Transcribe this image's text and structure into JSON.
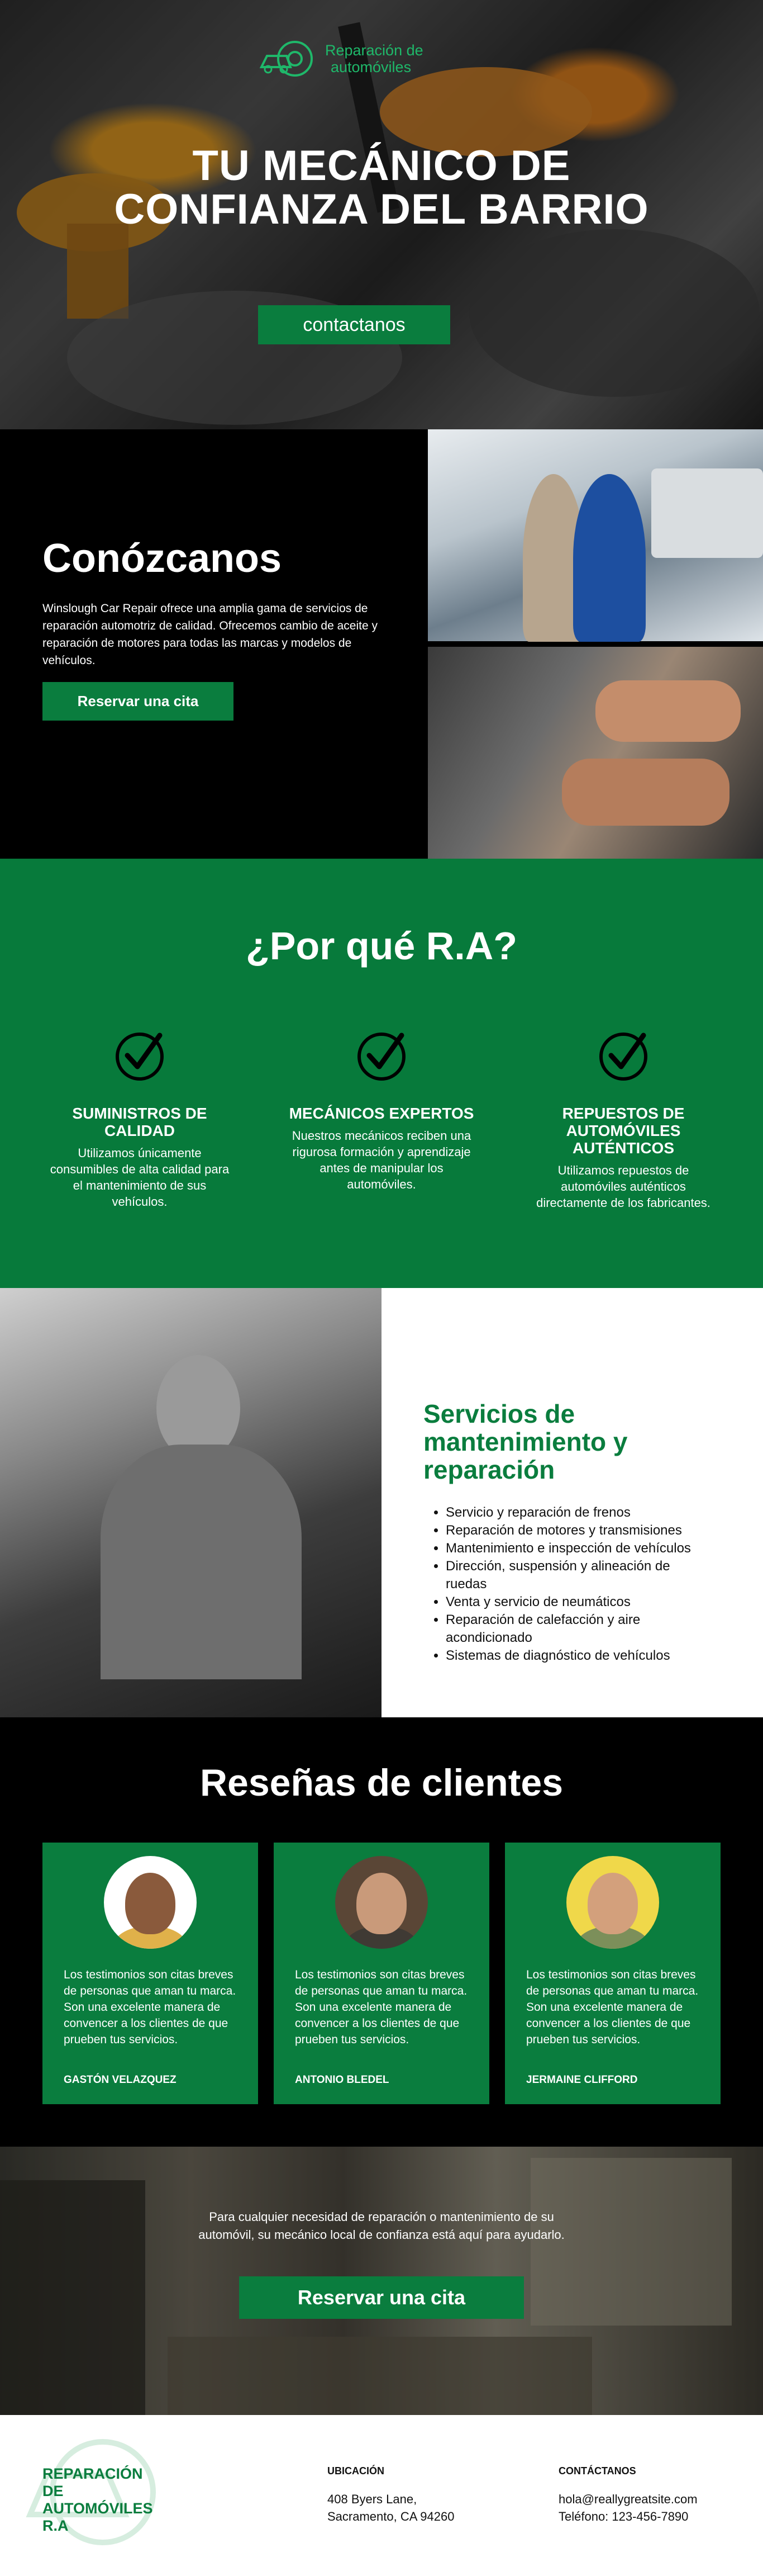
{
  "hero": {
    "logo_line1": "Reparación de",
    "logo_line2": "automóviles",
    "title": "TU MECÁNICO DE CONFIANZA DEL BARRIO",
    "button": "contactanos"
  },
  "about": {
    "title": "Conózcanos",
    "text": "Winslough Car Repair ofrece una amplia gama de servicios de reparación automotriz de calidad. Ofrecemos cambio de aceite y reparación de motores para todas las marcas y modelos de vehículos.",
    "button": "Reservar una cita"
  },
  "why": {
    "title": "¿Por qué R.A?",
    "features": [
      {
        "title": "SUMINISTROS DE CALIDAD",
        "text": "Utilizamos únicamente consumibles de alta calidad para el mantenimiento de sus vehículos.",
        "icon": "check-circle-icon"
      },
      {
        "title": "MECÁNICOS EXPERTOS",
        "text": "Nuestros mecánicos reciben una rigurosa formación y aprendizaje antes de manipular los automóviles.",
        "icon": "check-circle-icon"
      },
      {
        "title": "REPUESTOS DE AUTOMÓVILES AUTÉNTICOS",
        "text": "Utilizamos repuestos de automóviles auténticos directamente de los fabricantes.",
        "icon": "check-circle-icon"
      }
    ]
  },
  "services": {
    "title": "Servicios de mantenimiento y reparación",
    "items": [
      "Servicio y reparación de frenos",
      "Reparación de motores y transmisiones",
      "Mantenimiento e inspección de vehículos",
      "Dirección, suspensión y alineación de ruedas",
      "Venta y servicio de neumáticos",
      "Reparación de calefacción y aire acondicionado",
      "Sistemas de diagnóstico de vehículos"
    ]
  },
  "reviews": {
    "title": "Reseñas de clientes",
    "cards": [
      {
        "text": "Los testimonios son citas breves de personas que aman tu marca. Son una excelente manera de convencer a los clientes de que prueben tus servicios.",
        "name": "GASTÓN VELAZQUEZ"
      },
      {
        "text": "Los testimonios son citas breves de personas que aman tu marca. Son una excelente manera de convencer a los clientes de que prueben tus servicios.",
        "name": "ANTONIO BLEDEL"
      },
      {
        "text": "Los testimonios son citas breves de personas que aman tu marca. Son una excelente manera de convencer a los clientes de que prueben tus servicios.",
        "name": "JERMAINE CLIFFORD"
      }
    ]
  },
  "cta": {
    "text": "Para cualquier necesidad de reparación o mantenimiento de su automóvil, su mecánico local de confianza está aquí para ayudarlo.",
    "button": "Reservar una cita"
  },
  "footer": {
    "logo_line1": "REPARACIÓN",
    "logo_line2": "DE",
    "logo_line3": "AUTOMÓVILES",
    "logo_line4": "R.A",
    "location_title": "UBICACIÓN",
    "location_line1": "408 Byers Lane,",
    "location_line2": "Sacramento, CA 94260",
    "contact_title": "CONTÁCTANOS",
    "contact_line1": "hola@reallygreatsite.com",
    "contact_line2": "Teléfono: 123-456-7890"
  },
  "colors": {
    "brand_green": "#0a7d3e",
    "section_green": "#077a3b",
    "black": "#000000"
  }
}
